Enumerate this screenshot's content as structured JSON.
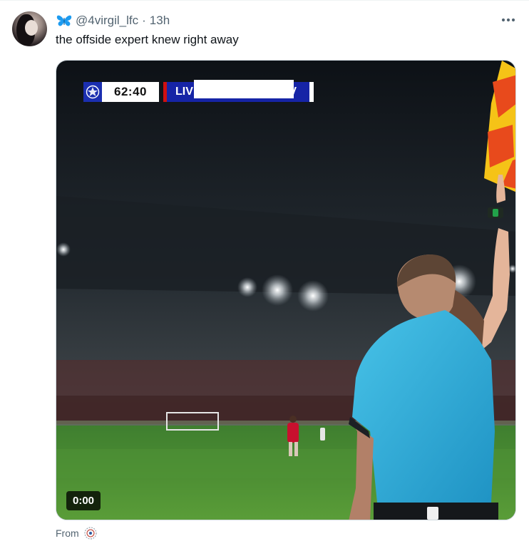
{
  "tweet": {
    "handle": "@4virgil_lfc",
    "separator": "·",
    "time": "13h",
    "text": "the offside expert knew right away",
    "from_label": "From"
  },
  "video": {
    "duration": "0:00",
    "scoreboard": {
      "clock": "62:40",
      "team_home": "LIV",
      "team_away": "V"
    }
  },
  "colors": {
    "accent_blue": "#1d9bf0",
    "muted_text": "#536471",
    "scoreboard_blue": "#1624a6",
    "scoreboard_red": "#d01010"
  },
  "icons": {
    "verified_badge": "butterfly-icon",
    "more": "more-icon",
    "from": "badge-icon"
  }
}
